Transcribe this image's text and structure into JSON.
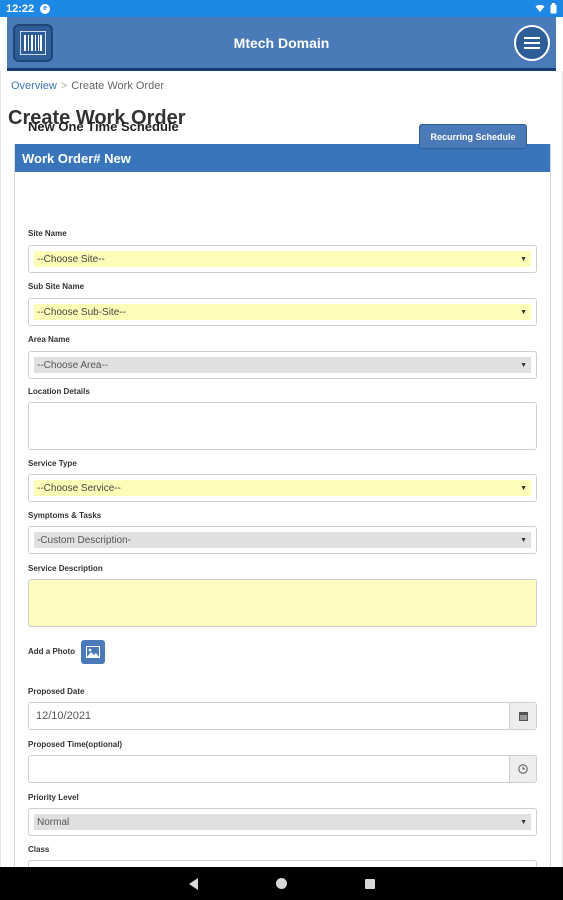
{
  "status_bar": {
    "time": "12:22",
    "notification_icon": "app-notification-icon"
  },
  "app_bar": {
    "title": "Mtech Domain",
    "left_icon": "barcode-icon",
    "right_icon": "menu-icon"
  },
  "breadcrumb": {
    "home": "Overview",
    "separator": ">",
    "current": "Create Work Order"
  },
  "page_title": "Create Work Order",
  "panel": {
    "header": "Work Order# New"
  },
  "schedule": {
    "title": "New One Time Schedule",
    "recurring_button": "Recurring Schedule"
  },
  "form": {
    "site": {
      "label": "Site Name",
      "value": "--Choose Site--"
    },
    "sub_site": {
      "label": "Sub Site Name",
      "value": "--Choose Sub-Site--"
    },
    "area": {
      "label": "Area Name",
      "value": "--Choose Area--"
    },
    "location": {
      "label": "Location Details",
      "value": ""
    },
    "service_type": {
      "label": "Service Type",
      "value": "--Choose Service--"
    },
    "symptoms": {
      "label": "Symptoms & Tasks",
      "value": "-Custom Description-"
    },
    "service_description": {
      "label": "Service Description",
      "value": ""
    },
    "photo": {
      "label": "Add a Photo",
      "icon": "image-icon"
    },
    "proposed_date": {
      "label": "Proposed Date",
      "value": "12/10/2021",
      "icon": "calendar-icon"
    },
    "proposed_time": {
      "label": "Proposed Time(optional)",
      "value": "",
      "icon": "clock-icon"
    },
    "priority": {
      "label": "Priority Level",
      "value": "Normal"
    },
    "class": {
      "label": "Class"
    }
  },
  "colors": {
    "status_bar": "#1e88e5",
    "app_bar": "#4a7ab8",
    "panel_header": "#3975bb",
    "highlight_yellow": "#fdfdb8",
    "disabled_gray": "#e0e0e0"
  }
}
